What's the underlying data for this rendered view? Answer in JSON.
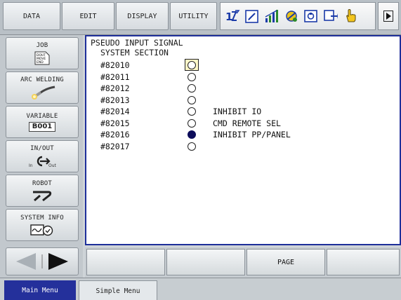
{
  "menubar": {
    "data_label": "DATA",
    "edit_label": "EDIT",
    "display_label": "DISPLAY",
    "utility_label": "UTILITY",
    "status_icons": [
      "axis-12-icon",
      "edit-lock-icon",
      "signal-bars-icon",
      "arc-status-icon",
      "teach-mode-icon",
      "play-mode-icon",
      "hand-pointer-icon"
    ],
    "play_icon": "play-triangle-icon"
  },
  "sidemenu": {
    "job_label": "JOB",
    "job_icon_text": "DOUT\nMOVE\nEND",
    "arc_label": "ARC WELDING",
    "variable_label": "VARIABLE",
    "variable_badge": "B001",
    "io_label": "IN/OUT",
    "io_in_text": "In",
    "io_out_text": "Out",
    "robot_label": "ROBOT",
    "sysinfo_label": "SYSTEM INFO"
  },
  "content": {
    "title": "PSEUDO INPUT SIGNAL",
    "section": "SYSTEM SECTION",
    "signals": [
      {
        "number": "#82010",
        "state": "off",
        "description": "",
        "cursor": true
      },
      {
        "number": "#82011",
        "state": "off",
        "description": "",
        "cursor": false
      },
      {
        "number": "#82012",
        "state": "off",
        "description": "",
        "cursor": false
      },
      {
        "number": "#82013",
        "state": "off",
        "description": "",
        "cursor": false
      },
      {
        "number": "#82014",
        "state": "off",
        "description": "INHIBIT IO",
        "cursor": false
      },
      {
        "number": "#82015",
        "state": "off",
        "description": "CMD REMOTE SEL",
        "cursor": false
      },
      {
        "number": "#82016",
        "state": "on",
        "description": "INHIBIT PP/PANEL",
        "cursor": false
      },
      {
        "number": "#82017",
        "state": "off",
        "description": "",
        "cursor": false
      }
    ]
  },
  "function_keys": [
    "",
    "",
    "PAGE",
    ""
  ],
  "tabs": {
    "main_menu": "Main Menu",
    "simple_menu": "Simple Menu"
  },
  "colors": {
    "active_tab": "#24309b",
    "content_border": "#1e2f9a",
    "signal_on": "#0c0c5a"
  }
}
